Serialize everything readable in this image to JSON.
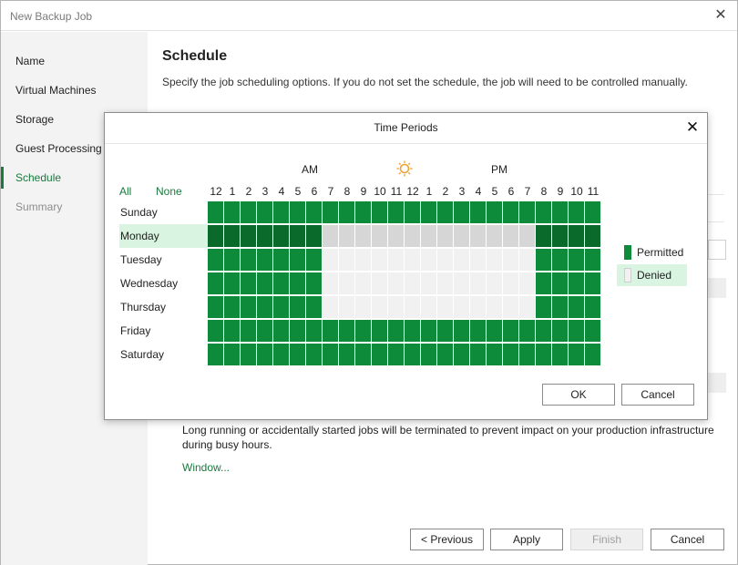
{
  "window": {
    "title": "New Backup Job"
  },
  "sidebar": {
    "items": [
      {
        "label": "Name",
        "state": "normal"
      },
      {
        "label": "Virtual Machines",
        "state": "normal"
      },
      {
        "label": "Storage",
        "state": "normal"
      },
      {
        "label": "Guest Processing",
        "state": "normal"
      },
      {
        "label": "Schedule",
        "state": "active"
      },
      {
        "label": "Summary",
        "state": "disabled"
      }
    ]
  },
  "main": {
    "heading": "Schedule",
    "description": "Specify the job scheduling options. If you do not set the schedule, the job will need to be controlled manually.",
    "termination_text": "Long running or accidentally started jobs will be terminated to prevent impact on your production infrastructure during busy hours.",
    "window_link": "Window..."
  },
  "footer": {
    "previous_label": "< Previous",
    "apply_label": "Apply",
    "finish_label": "Finish",
    "cancel_label": "Cancel"
  },
  "dialog": {
    "title": "Time Periods",
    "am_label": "AM",
    "pm_label": "PM",
    "all_label": "All",
    "none_label": "None",
    "hours": [
      "12",
      "1",
      "2",
      "3",
      "4",
      "5",
      "6",
      "7",
      "8",
      "9",
      "10",
      "11",
      "12",
      "1",
      "2",
      "3",
      "4",
      "5",
      "6",
      "7",
      "8",
      "9",
      "10",
      "11"
    ],
    "days": [
      "Sunday",
      "Monday",
      "Tuesday",
      "Wednesday",
      "Thursday",
      "Friday",
      "Saturday"
    ],
    "selected_day": "Monday",
    "legend_permitted": "Permitted",
    "legend_denied": "Denied",
    "ok_label": "OK",
    "cancel_label": "Cancel",
    "schedule": [
      "PPPPPPPPPPPPPPPPPPPPPPPP",
      "PPPPPPPDDDDDDDDDDDDDPPPP",
      "PPPPPPPDDDDDDDDDDDDDPPPP",
      "PPPPPPPDDDDDDDDDDDDDPPPP",
      "PPPPPPPDDDDDDDDDDDDDPPPP",
      "PPPPPPPPPPPPPPPPPPPPPPPP",
      "PPPPPPPPPPPPPPPPPPPPPPPP"
    ],
    "colors": {
      "permitted": "#0d8a3a",
      "permitted_selected": "#0a6a2b",
      "denied": "#f1f1f1",
      "denied_selected": "#d6d6d6",
      "accent": "#1a7a3c",
      "sun": "#f0a030",
      "moon": "#1a6fc4"
    }
  }
}
